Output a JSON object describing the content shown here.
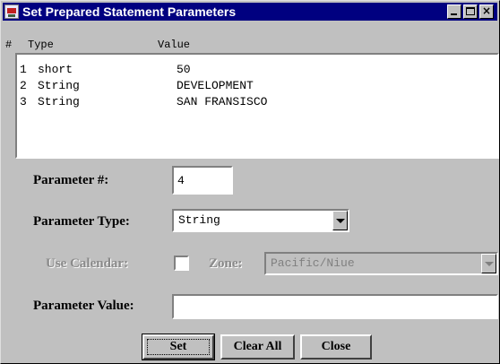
{
  "window": {
    "title": "Set Prepared Statement Parameters"
  },
  "table": {
    "columns": [
      "#",
      "Type",
      "Value"
    ],
    "rows": [
      {
        "num": "1",
        "type": "short",
        "value": "50"
      },
      {
        "num": "2",
        "type": "String",
        "value": "DEVELOPMENT"
      },
      {
        "num": "3",
        "type": "String",
        "value": "SAN FRANSISCO"
      }
    ]
  },
  "form": {
    "param_num_label": "Parameter #:",
    "param_num_value": "4",
    "param_type_label": "Parameter Type:",
    "param_type_value": "String",
    "use_calendar_label": "Use Calendar:",
    "use_calendar_checked": false,
    "zone_label": "Zone:",
    "zone_value": "Pacific/Niue",
    "param_value_label": "Parameter Value:",
    "param_value": ""
  },
  "buttons": {
    "set": "Set",
    "clear_all": "Clear All",
    "close": "Close"
  },
  "colors": {
    "titlebar": "#000080",
    "window_bg": "#c0c0c0",
    "disabled_text": "#8a8a8a"
  }
}
